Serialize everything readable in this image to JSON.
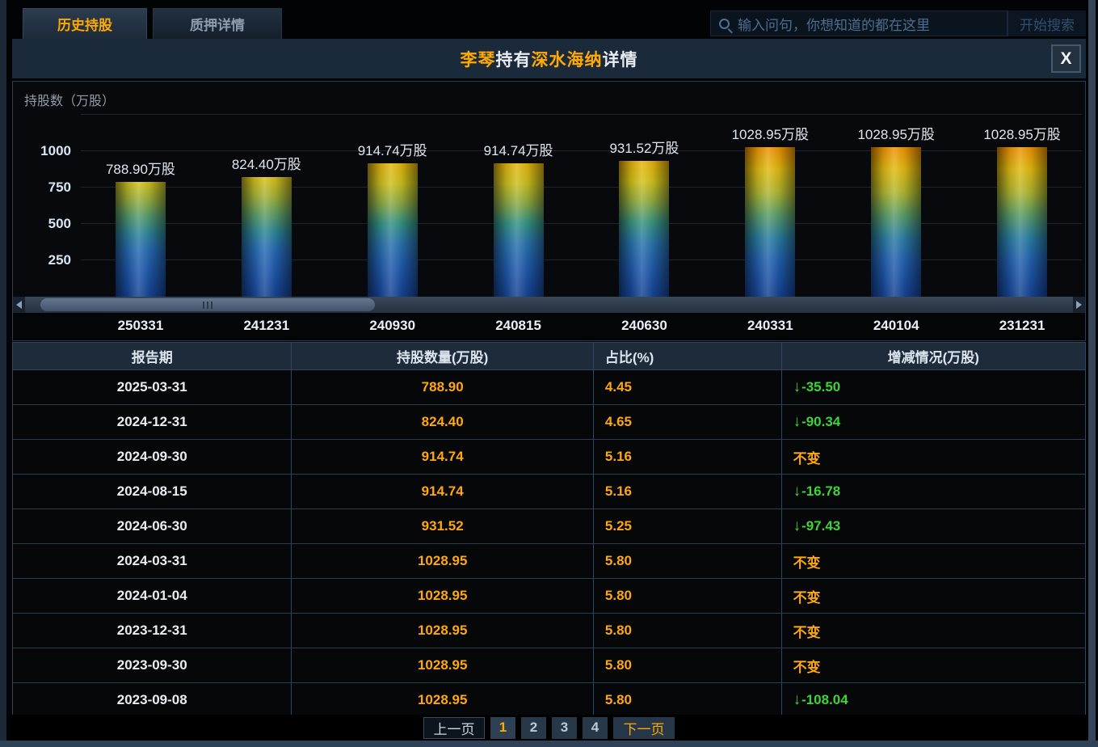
{
  "tabs": [
    {
      "label": "历史持股",
      "active": true
    },
    {
      "label": "质押详情",
      "active": false
    }
  ],
  "search": {
    "placeholder": "输入问句，你想知道的都在这里",
    "button_label": "开始搜索",
    "icon": "search-icon"
  },
  "dialog": {
    "title_parts": [
      {
        "text": "李琴",
        "highlight": true
      },
      {
        "text": "持有",
        "highlight": false
      },
      {
        "text": "深水海纳",
        "highlight": true
      },
      {
        "text": "详情",
        "highlight": false
      }
    ],
    "close_label": "X"
  },
  "chart_data": {
    "type": "bar",
    "title": "李琴持有深水海纳详情",
    "ylabel": "持股数（万股）",
    "xlabel": "",
    "categories": [
      "250331",
      "241231",
      "240930",
      "240815",
      "240630",
      "240331",
      "240104",
      "231231"
    ],
    "values": [
      788.9,
      824.4,
      914.74,
      914.74,
      931.52,
      1028.95,
      1028.95,
      1028.95
    ],
    "bar_labels": [
      "788.90万股",
      "824.40万股",
      "914.74万股",
      "914.74万股",
      "931.52万股",
      "1028.95万股",
      "1028.95万股",
      "1028.95万股"
    ],
    "yticks": [
      250,
      500,
      750,
      1000
    ],
    "ylim": [
      0,
      1255
    ],
    "grid": true,
    "legend": false,
    "scrollbar": true,
    "bar_color_scale": [
      {
        "v": 1060,
        "rgb": [
          240,
          134,
          2
        ]
      },
      {
        "v": 930,
        "rgb": [
          232,
          180,
          12
        ]
      },
      {
        "v": 800,
        "rgb": [
          216,
          196,
          24
        ]
      },
      {
        "v": 640,
        "rgb": [
          140,
          170,
          70
        ]
      },
      {
        "v": 500,
        "rgb": [
          50,
          148,
          135
        ]
      },
      {
        "v": 340,
        "rgb": [
          40,
          110,
          182
        ]
      },
      {
        "v": 150,
        "rgb": [
          30,
          85,
          170
        ]
      },
      {
        "v": 0,
        "rgb": [
          22,
          68,
          148
        ]
      }
    ]
  },
  "table": {
    "headers": [
      "报告期",
      "持股数量(万股)",
      "占比(%)",
      "增减情况(万股)"
    ],
    "rows": [
      {
        "date": "2025-03-31",
        "qty": "788.90",
        "pct": "4.45",
        "change": "-35.50",
        "change_type": "down"
      },
      {
        "date": "2024-12-31",
        "qty": "824.40",
        "pct": "4.65",
        "change": "-90.34",
        "change_type": "down"
      },
      {
        "date": "2024-09-30",
        "qty": "914.74",
        "pct": "5.16",
        "change": "不变",
        "change_type": "same"
      },
      {
        "date": "2024-08-15",
        "qty": "914.74",
        "pct": "5.16",
        "change": "-16.78",
        "change_type": "down"
      },
      {
        "date": "2024-06-30",
        "qty": "931.52",
        "pct": "5.25",
        "change": "-97.43",
        "change_type": "down"
      },
      {
        "date": "2024-03-31",
        "qty": "1028.95",
        "pct": "5.80",
        "change": "不变",
        "change_type": "same"
      },
      {
        "date": "2024-01-04",
        "qty": "1028.95",
        "pct": "5.80",
        "change": "不变",
        "change_type": "same"
      },
      {
        "date": "2023-12-31",
        "qty": "1028.95",
        "pct": "5.80",
        "change": "不变",
        "change_type": "same"
      },
      {
        "date": "2023-09-30",
        "qty": "1028.95",
        "pct": "5.80",
        "change": "不变",
        "change_type": "same"
      },
      {
        "date": "2023-09-08",
        "qty": "1028.95",
        "pct": "5.80",
        "change": "-108.04",
        "change_type": "down"
      }
    ]
  },
  "pagination": {
    "prev_label": "上一页",
    "pages": [
      "1",
      "2",
      "3",
      "4"
    ],
    "active_page": "1",
    "next_label": "下一页"
  },
  "colors": {
    "accent_orange": "#ffaa00",
    "value_orange": "#ffa70f",
    "change_green": "#3fd435",
    "panel_blue": "#1b2a3a",
    "frame_blue": "#2e4156"
  }
}
